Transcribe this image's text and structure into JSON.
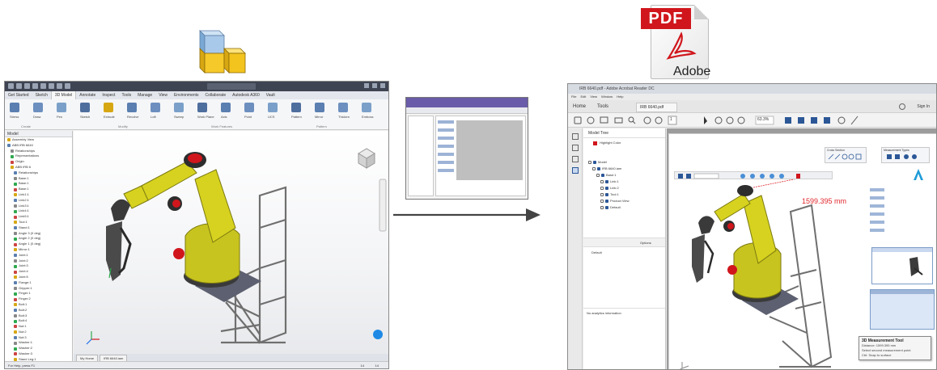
{
  "pdf_icon": {
    "banner": "PDF",
    "brand": "Adobe"
  },
  "inventor": {
    "tabs": [
      "Get Started",
      "Sketch",
      "3D Model",
      "Annotate",
      "Inspect",
      "Tools",
      "Manage",
      "View",
      "Environments",
      "Collaborate",
      "Autodesk A360",
      "Vault"
    ],
    "active_tab_index": 2,
    "ribbon_buttons": [
      "Stress",
      "Draw",
      "Pen",
      "Sketch",
      "Extrude",
      "Revolve",
      "Loft",
      "Sweep",
      "Work Plane",
      "Axis",
      "Point",
      "UCS",
      "Pattern",
      "Mirror",
      "Thicken",
      "Emboss"
    ],
    "ribbon_panels": [
      "Create",
      "Modify",
      "Work Features",
      "Pattern"
    ],
    "browser_header": "Model",
    "browser_items": [
      "Assembly View",
      "ABB IRB 6640",
      "Relationships",
      "Representations",
      "Origin",
      "ABB IRB 6",
      "Relationships",
      "Base:1",
      "Base:1",
      "Base:1",
      "Link1:1",
      "Link2:1",
      "Link3:1",
      "Link4:1",
      "Link5:1",
      "Tool:1",
      "Stand:1",
      "Angle 3 (0 deg)",
      "Angle 2 (0 deg)",
      "Angle 1 (0 deg)",
      "Mirror:1",
      "Joint:1",
      "Joint:2",
      "Joint:3",
      "Joint:4",
      "Joint:5",
      "Flange:1",
      "Gripper:1",
      "Finger:1",
      "Finger:2",
      "Bolt:1",
      "Bolt:2",
      "Bolt:3",
      "Bolt:4",
      "Nut:1",
      "Nut:2",
      "Nut:3",
      "Washer:1",
      "Washer:2",
      "Washer:3",
      "Stand Leg:1",
      "Stand Leg:2",
      "Stand Leg:3",
      "Stand Leg:4"
    ],
    "doc_tabs": [
      "My Home",
      "IRB 6640.iam"
    ],
    "status_text": "For Help, press F1",
    "status_right": [
      "14",
      "14"
    ]
  },
  "acrobat": {
    "title": "IRB 6640.pdf - Adobe Acrobat Reader DC",
    "menu": [
      "File",
      "Edit",
      "View",
      "Window",
      "Help"
    ],
    "tabs": [
      "Home",
      "Tools",
      "IRB 6640.pdf"
    ],
    "sign_in": "Sign In",
    "zoom": "63.3%",
    "page_num": "1",
    "model_tree_title": "Model Tree",
    "highlight_label": "Highlight Color",
    "tree_items": [
      "Model",
      "IRB 6640.iam",
      "Base:1",
      "Link:1",
      "Link:2",
      "Tool:1",
      "Product View",
      "Default"
    ],
    "views_label": "Options",
    "views_item": "Default",
    "no_info": "No analytics information",
    "measurement_label": "1599.395 mm",
    "tooltip_title": "3D Measurement Tool",
    "tooltip_lines": [
      "Distance: 1599.395 mm",
      "Select second measurement point",
      "Ctrl: Snap to surface"
    ],
    "cross_section_title": "Cross Section",
    "measurement_types": "Measurement Types",
    "brand_letter": "A",
    "accent_color": "#1f6feb",
    "pdf_red": "#d0161c"
  }
}
